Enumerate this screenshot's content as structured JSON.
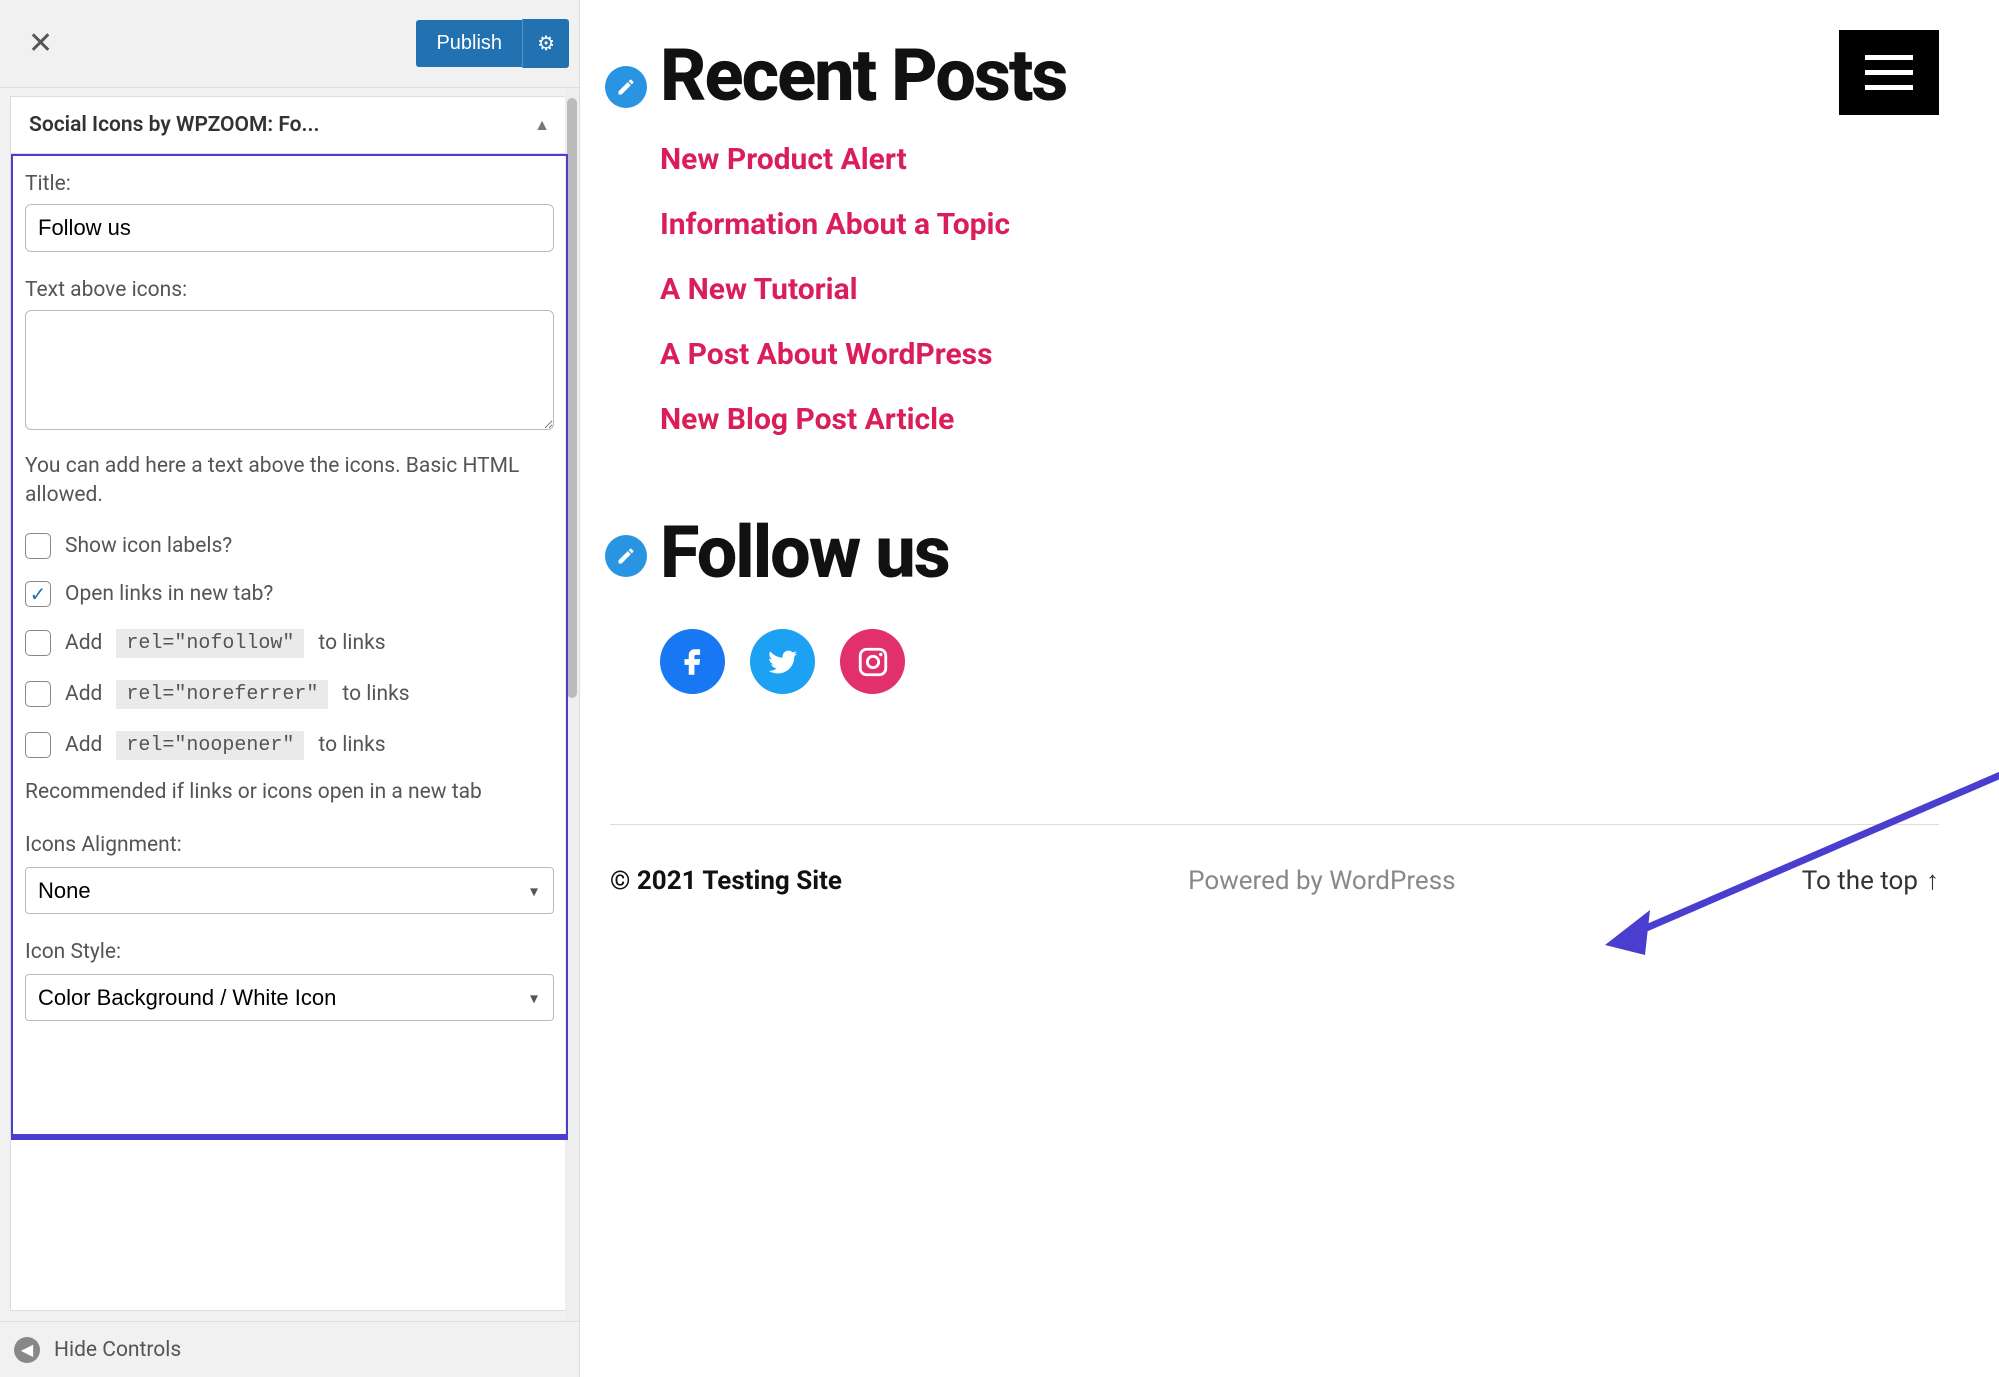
{
  "sidebar": {
    "publish_label": "Publish",
    "accordion_title": "Social Icons by WPZOOM: Fo...",
    "title_label": "Title:",
    "title_value": "Follow us",
    "text_above_label": "Text above icons:",
    "text_above_value": "",
    "help_text": "You can add here a text above the icons. Basic HTML allowed.",
    "show_labels_label": "Show icon labels?",
    "open_new_tab_label": "Open links in new tab?",
    "add_label": "Add",
    "rel_nofollow": "rel=\"nofollow\"",
    "rel_noreferrer": "rel=\"noreferrer\"",
    "rel_noopener": "rel=\"noopener\"",
    "to_links": "to links",
    "recommended_text": "Recommended if links or icons open in a new tab",
    "alignment_label": "Icons Alignment:",
    "alignment_value": "None",
    "icon_style_label": "Icon Style:",
    "icon_style_value": "Color Background / White Icon",
    "hide_controls": "Hide Controls"
  },
  "preview": {
    "recent_posts_title": "Recent Posts",
    "posts": [
      "New Product Alert",
      "Information About a Topic",
      "A New Tutorial",
      "A Post About WordPress",
      "New Blog Post Article"
    ],
    "follow_title": "Follow us",
    "social": [
      "facebook",
      "twitter",
      "instagram"
    ],
    "footer_copy": "© 2021 Testing Site",
    "footer_powered": "Powered by WordPress",
    "footer_top": "To the top"
  }
}
